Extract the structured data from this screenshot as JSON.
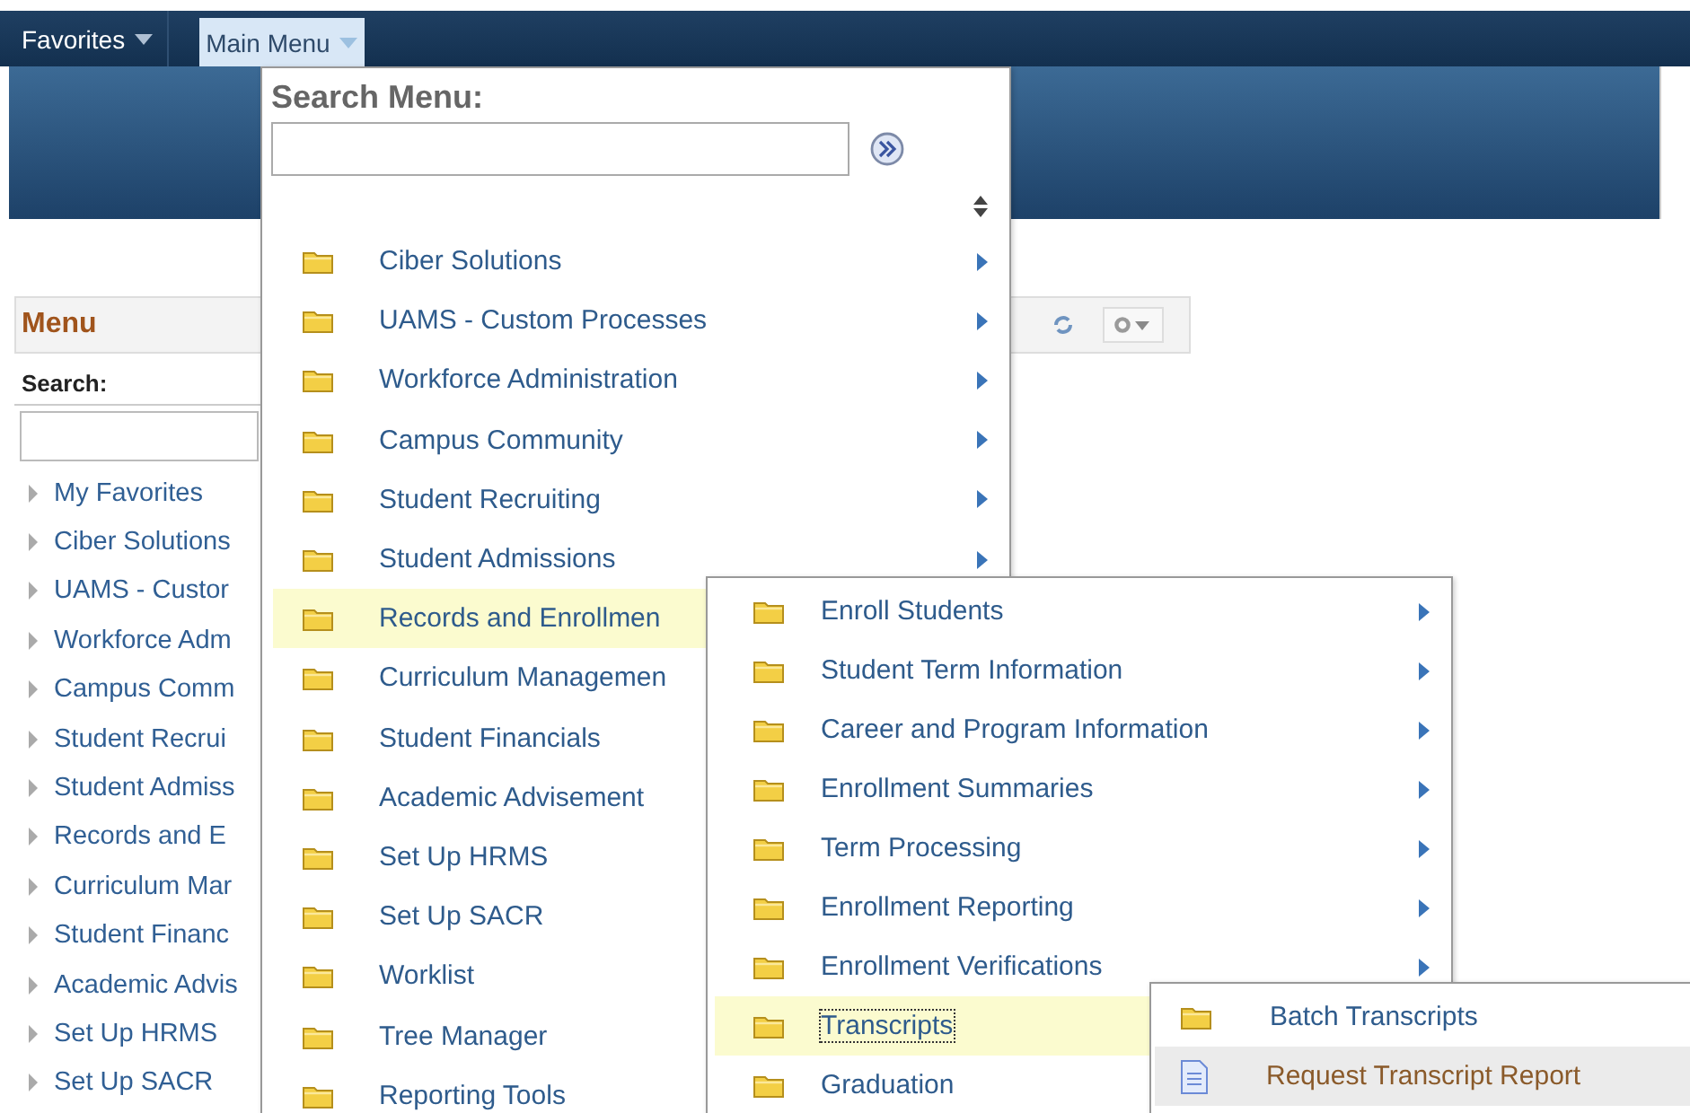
{
  "nav": {
    "favorites": {
      "label": "Favorites"
    },
    "main_menu": {
      "label": "Main Menu",
      "selected": true
    }
  },
  "menu_pagelet": {
    "title": "Menu",
    "search_label": "Search:",
    "items": [
      {
        "label": "My Favorites"
      },
      {
        "label": "Ciber Solutions"
      },
      {
        "label": "UAMS - Custor"
      },
      {
        "label": "Workforce Adm"
      },
      {
        "label": "Campus Comm"
      },
      {
        "label": "Student Recrui"
      },
      {
        "label": "Student Admiss"
      },
      {
        "label": "Records and E"
      },
      {
        "label": "Curriculum Mar"
      },
      {
        "label": "Student Financ"
      },
      {
        "label": "Academic Advis"
      },
      {
        "label": "Set Up HRMS"
      },
      {
        "label": "Set Up SACR"
      }
    ]
  },
  "main_menu_dropdown": {
    "search_label": "Search Menu:",
    "items": [
      {
        "label": "Ciber Solutions",
        "kind": "folder",
        "arrow": true,
        "selected": false
      },
      {
        "label": "UAMS - Custom Processes",
        "kind": "folder",
        "arrow": true,
        "selected": false
      },
      {
        "label": "Workforce Administration",
        "kind": "folder",
        "arrow": true,
        "selected": false
      },
      {
        "label": "Campus Community",
        "kind": "folder",
        "arrow": true,
        "selected": false
      },
      {
        "label": "Student Recruiting",
        "kind": "folder",
        "arrow": true,
        "selected": false
      },
      {
        "label": "Student Admissions",
        "kind": "folder",
        "arrow": true,
        "selected": false
      },
      {
        "label": "Records and Enrollmen",
        "kind": "folder",
        "selected": true
      },
      {
        "label": "Curriculum Managemen",
        "kind": "folder",
        "selected": false
      },
      {
        "label": "Student Financials",
        "kind": "folder",
        "selected": false
      },
      {
        "label": "Academic Advisement",
        "kind": "folder",
        "selected": false
      },
      {
        "label": "Set Up HRMS",
        "kind": "folder",
        "selected": false
      },
      {
        "label": "Set Up SACR",
        "kind": "folder",
        "selected": false
      },
      {
        "label": "Worklist",
        "kind": "folder",
        "selected": false
      },
      {
        "label": "Tree Manager",
        "kind": "folder",
        "selected": false
      },
      {
        "label": "Reporting Tools",
        "kind": "folder",
        "selected": false
      }
    ]
  },
  "submenu": {
    "items": [
      {
        "label": "Enroll Students",
        "kind": "folder",
        "arrow": true,
        "selected": false,
        "focused": false
      },
      {
        "label": "Student Term Information",
        "kind": "folder",
        "arrow": true,
        "selected": false,
        "focused": false
      },
      {
        "label": "Career and Program Information",
        "kind": "folder",
        "arrow": true,
        "selected": false,
        "focused": false
      },
      {
        "label": "Enrollment Summaries",
        "kind": "folder",
        "arrow": true,
        "selected": false,
        "focused": false
      },
      {
        "label": "Term Processing",
        "kind": "folder",
        "arrow": true,
        "selected": false,
        "focused": false
      },
      {
        "label": "Enrollment Reporting",
        "kind": "folder",
        "arrow": true,
        "selected": false,
        "focused": false
      },
      {
        "label": "Enrollment Verifications",
        "kind": "folder",
        "arrow": true,
        "selected": false,
        "focused": false
      },
      {
        "label": "Transcripts",
        "kind": "folder",
        "selected": true,
        "focused": true
      },
      {
        "label": "Graduation",
        "kind": "folder",
        "selected": false,
        "focused": false
      }
    ]
  },
  "subsubmenu": {
    "items": [
      {
        "label": "Batch Transcripts",
        "kind": "folder",
        "selected": false
      },
      {
        "label": "Request Transcript Report",
        "kind": "document",
        "selected": true
      }
    ]
  }
}
